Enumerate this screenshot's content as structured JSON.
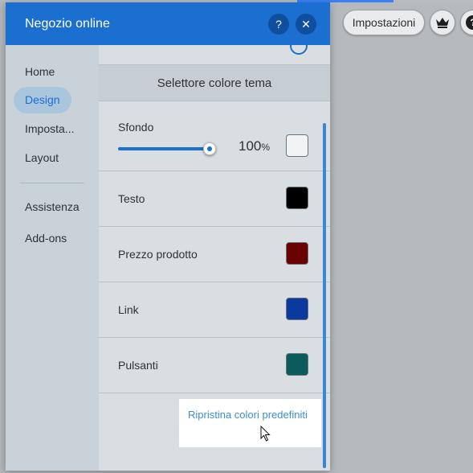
{
  "toolbar": {
    "settings_label": "Impostazioni",
    "crown_icon": "crown-icon",
    "help_glyph": "?"
  },
  "panel": {
    "title": "Negozio online",
    "help_glyph": "?",
    "close_glyph": "✕"
  },
  "sidebar": {
    "items": [
      {
        "label": "Home"
      },
      {
        "label": "Design"
      },
      {
        "label": "Imposta..."
      },
      {
        "label": "Layout"
      },
      {
        "label": "Assistenza"
      },
      {
        "label": "Add-ons"
      }
    ],
    "active": "Design"
  },
  "content": {
    "section_title": "Selettore colore tema",
    "background": {
      "label": "Sfondo",
      "opacity_value": "100",
      "opacity_unit": "%",
      "color": "#f1f3f4"
    },
    "colors": [
      {
        "label": "Testo",
        "color": "#000000"
      },
      {
        "label": "Prezzo prodotto",
        "color": "#6b0000"
      },
      {
        "label": "Link",
        "color": "#0a3aa0"
      },
      {
        "label": "Pulsanti",
        "color": "#0b5a5c"
      }
    ],
    "reset_label": "Ripristina colori predefiniti"
  }
}
